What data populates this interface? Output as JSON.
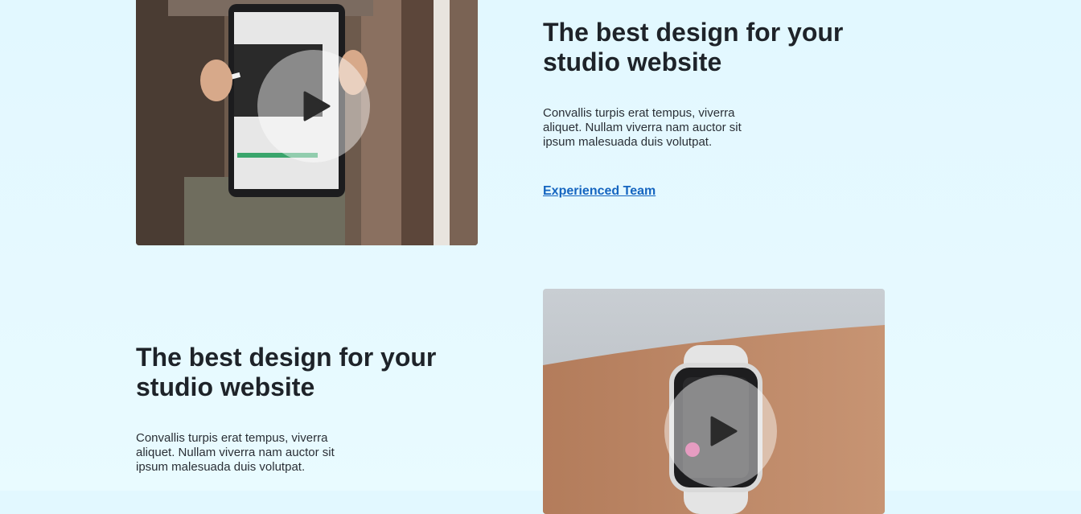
{
  "feature_top": {
    "heading": "The best design for your studio website",
    "body": "Convallis turpis erat tempus, viverra aliquet. Nullam viverra nam auctor sit ipsum malesuada duis volutpat.",
    "link": "Experienced Team",
    "image_alt": "person-holding-tablet",
    "play_icon": "play-icon"
  },
  "feature_bottom": {
    "heading": "The best design for your studio website",
    "body": "Convallis turpis erat tempus, viverra aliquet. Nullam viverra nam auctor sit ipsum malesuada duis volutpat.",
    "image_alt": "smartwatch-on-wrist",
    "play_icon": "play-icon"
  },
  "colors": {
    "background": "#e2f8ff",
    "heading": "#1e2329",
    "link": "#1565c0"
  }
}
